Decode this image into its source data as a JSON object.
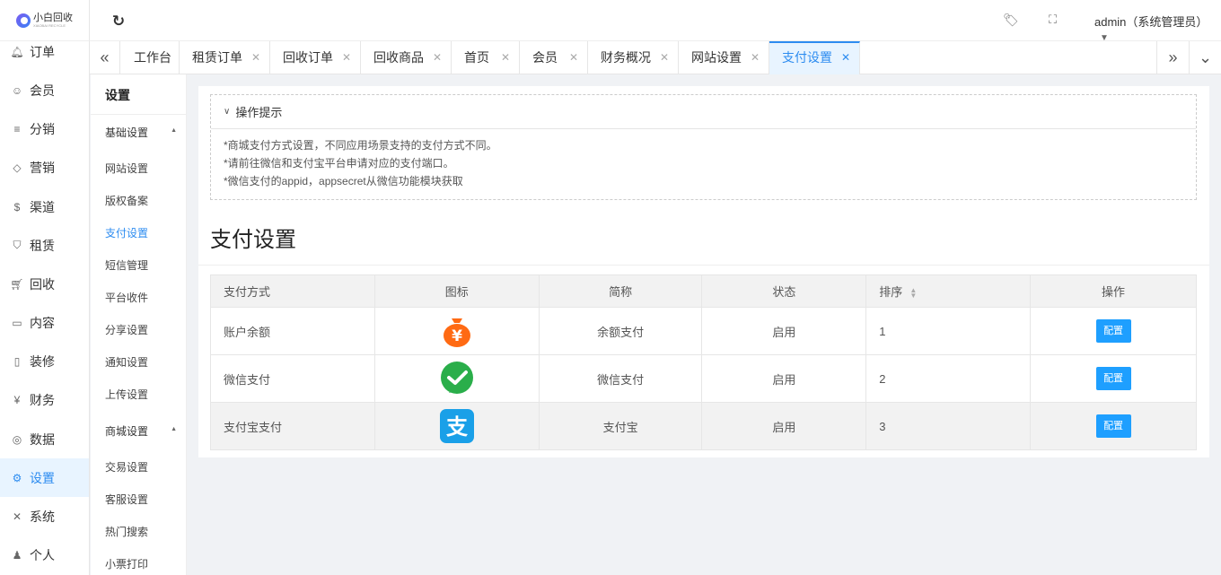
{
  "logo": {
    "name": "小白回收",
    "sub": "XIAOBAI RECYCLE"
  },
  "menu": [
    {
      "label": "订单",
      "icon": "bell-icon",
      "glyph": "🔔︎"
    },
    {
      "label": "会员",
      "icon": "user-icon",
      "glyph": "☺"
    },
    {
      "label": "分销",
      "icon": "layers-icon",
      "glyph": "≡"
    },
    {
      "label": "营销",
      "icon": "diamond-icon",
      "glyph": "◇"
    },
    {
      "label": "渠道",
      "icon": "dollar-icon",
      "glyph": "$"
    },
    {
      "label": "租赁",
      "icon": "shield-icon",
      "glyph": "⛉"
    },
    {
      "label": "回收",
      "icon": "cart-icon",
      "glyph": "🛒︎"
    },
    {
      "label": "内容",
      "icon": "book-icon",
      "glyph": "▭"
    },
    {
      "label": "装修",
      "icon": "tablet-icon",
      "glyph": "▯"
    },
    {
      "label": "财务",
      "icon": "yen-icon",
      "glyph": "¥"
    },
    {
      "label": "数据",
      "icon": "globe-icon",
      "glyph": "◎"
    },
    {
      "label": "设置",
      "icon": "gear-icon",
      "glyph": "⚙"
    },
    {
      "label": "系统",
      "icon": "tools-icon",
      "glyph": "✕"
    },
    {
      "label": "个人",
      "icon": "person-icon",
      "glyph": "♟"
    }
  ],
  "header": {
    "user": "admin（系统管理员）"
  },
  "tabs": [
    {
      "label": "工作台"
    },
    {
      "label": "租赁订单"
    },
    {
      "label": "回收订单"
    },
    {
      "label": "回收商品"
    },
    {
      "label": "首页"
    },
    {
      "label": "会员"
    },
    {
      "label": "财务概况"
    },
    {
      "label": "网站设置"
    },
    {
      "label": "支付设置"
    }
  ],
  "submenu": {
    "title": "设置",
    "groups": [
      {
        "label": "基础设置",
        "items": [
          "网站设置",
          "版权备案",
          "支付设置",
          "短信管理",
          "平台收件",
          "分享设置",
          "通知设置",
          "上传设置"
        ]
      },
      {
        "label": "商城设置",
        "items": [
          "交易设置",
          "客服设置",
          "热门搜索",
          "小票打印"
        ]
      }
    ]
  },
  "tips": {
    "title": "操作提示",
    "lines": [
      "*商城支付方式设置，不同应用场景支持的支付方式不同。",
      "*请前往微信和支付宝平台申请对应的支付端口。",
      "*微信支付的appid，appsecret从微信功能模块获取"
    ]
  },
  "page_title": "支付设置",
  "table": {
    "headers": [
      "支付方式",
      "图标",
      "简称",
      "状态",
      "排序",
      "操作"
    ],
    "rows": [
      {
        "method": "账户余额",
        "icon": "balance-icon",
        "short": "余额支付",
        "status": "启用",
        "sort": "1",
        "action": "配置"
      },
      {
        "method": "微信支付",
        "icon": "wechat-icon",
        "short": "微信支付",
        "status": "启用",
        "sort": "2",
        "action": "配置"
      },
      {
        "method": "支付宝支付",
        "icon": "alipay-icon",
        "short": "支付宝",
        "status": "启用",
        "sort": "3",
        "action": "配置"
      }
    ]
  },
  "colors": {
    "accent": "#2d8cf0",
    "button": "#1e9fff",
    "balance": "#ff6a13",
    "wechat": "#2aae4a",
    "alipay": "#1aa0e8"
  }
}
